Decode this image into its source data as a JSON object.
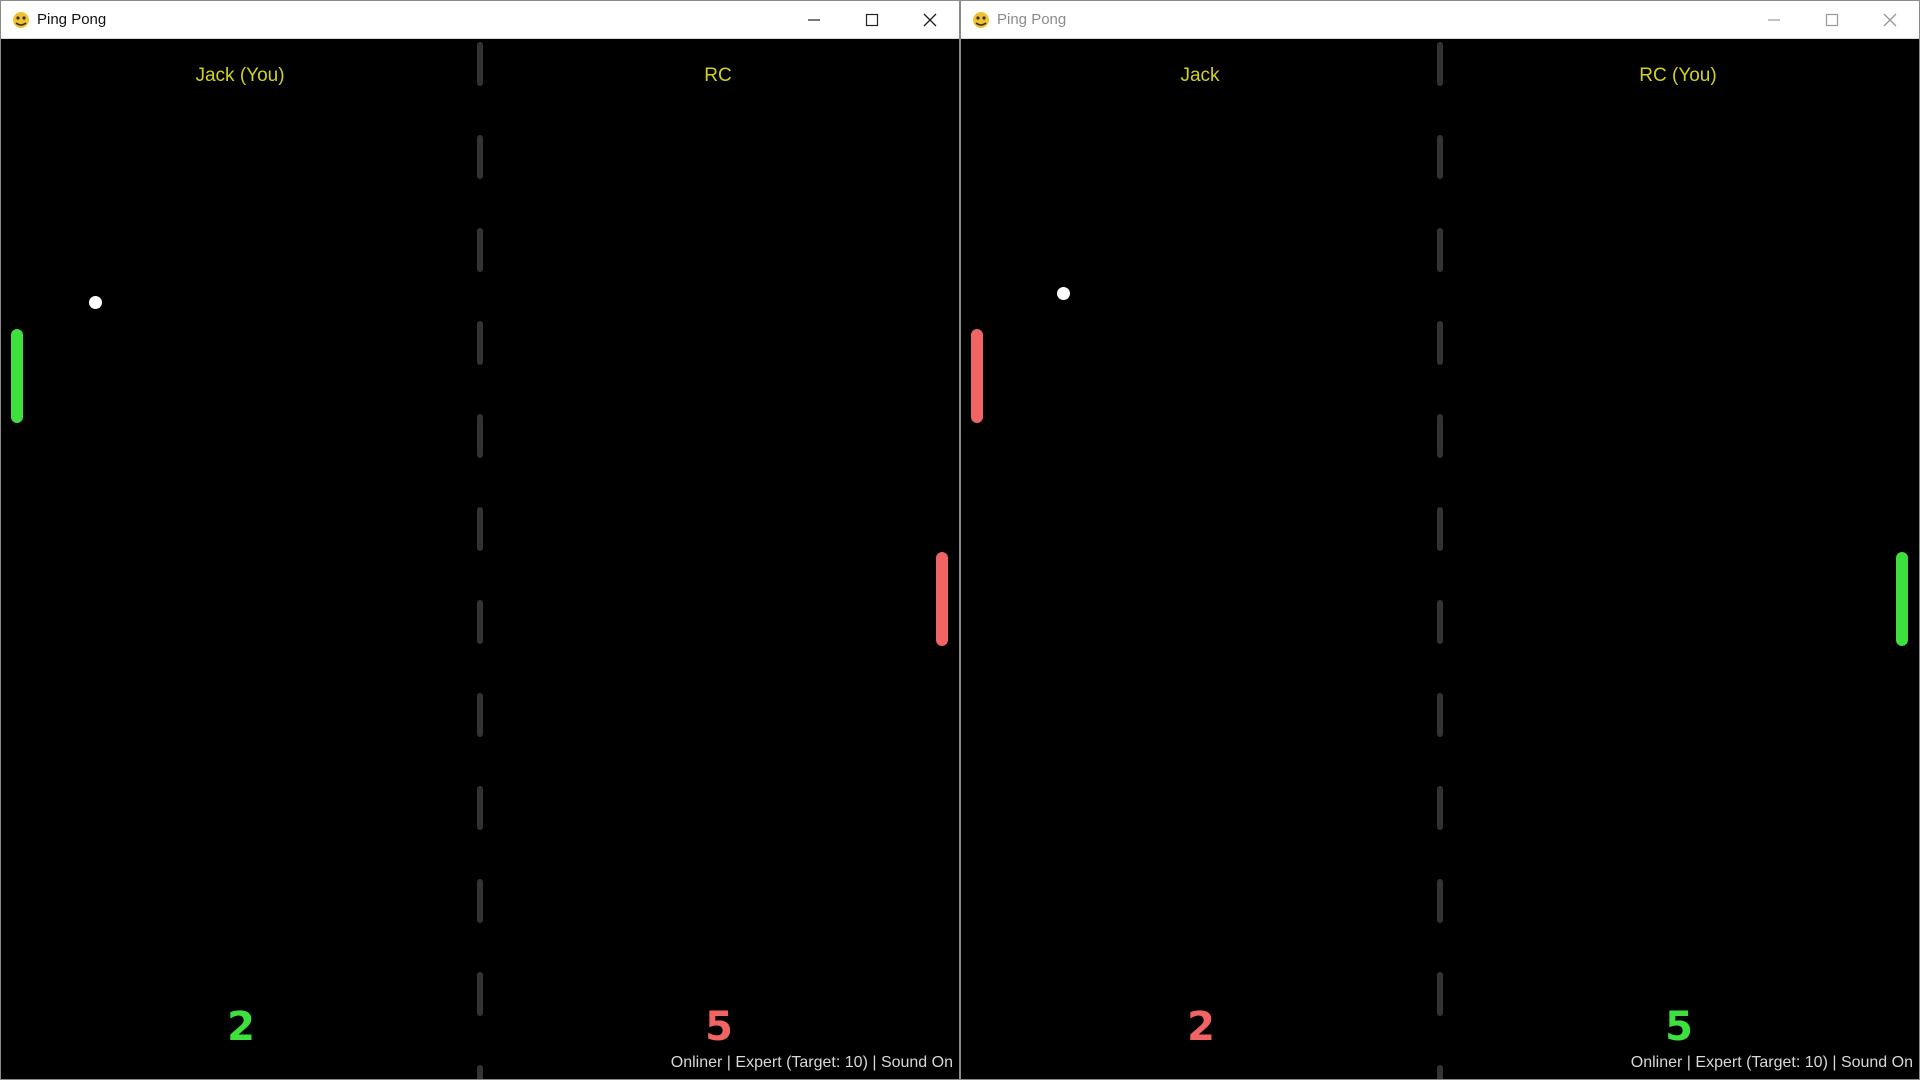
{
  "windows": [
    {
      "title": "Ping Pong",
      "active": true,
      "left_player": {
        "name": "Jack (You)",
        "score": "2",
        "color": "#3ee03e"
      },
      "right_player": {
        "name": "RC",
        "score": "5",
        "color": "#f06464"
      },
      "status": "Onliner | Expert (Target: 10) | Sound On"
    },
    {
      "title": "Ping Pong",
      "active": false,
      "left_player": {
        "name": "Jack",
        "score": "2",
        "color": "#f06464"
      },
      "right_player": {
        "name": "RC (You)",
        "score": "5",
        "color": "#3ee03e"
      },
      "status": "Onliner | Expert (Target: 10) | Sound On"
    }
  ],
  "colors": {
    "player_name": "#d2d21e",
    "self_color": "#3ee03e",
    "opponent_color": "#f06464",
    "background": "#000000",
    "ball": "#ffffff",
    "center_line": "#333333"
  },
  "icons": {
    "app": "pygame-snake-icon",
    "minimize": "minimize-icon",
    "maximize": "maximize-icon",
    "close": "close-icon"
  }
}
